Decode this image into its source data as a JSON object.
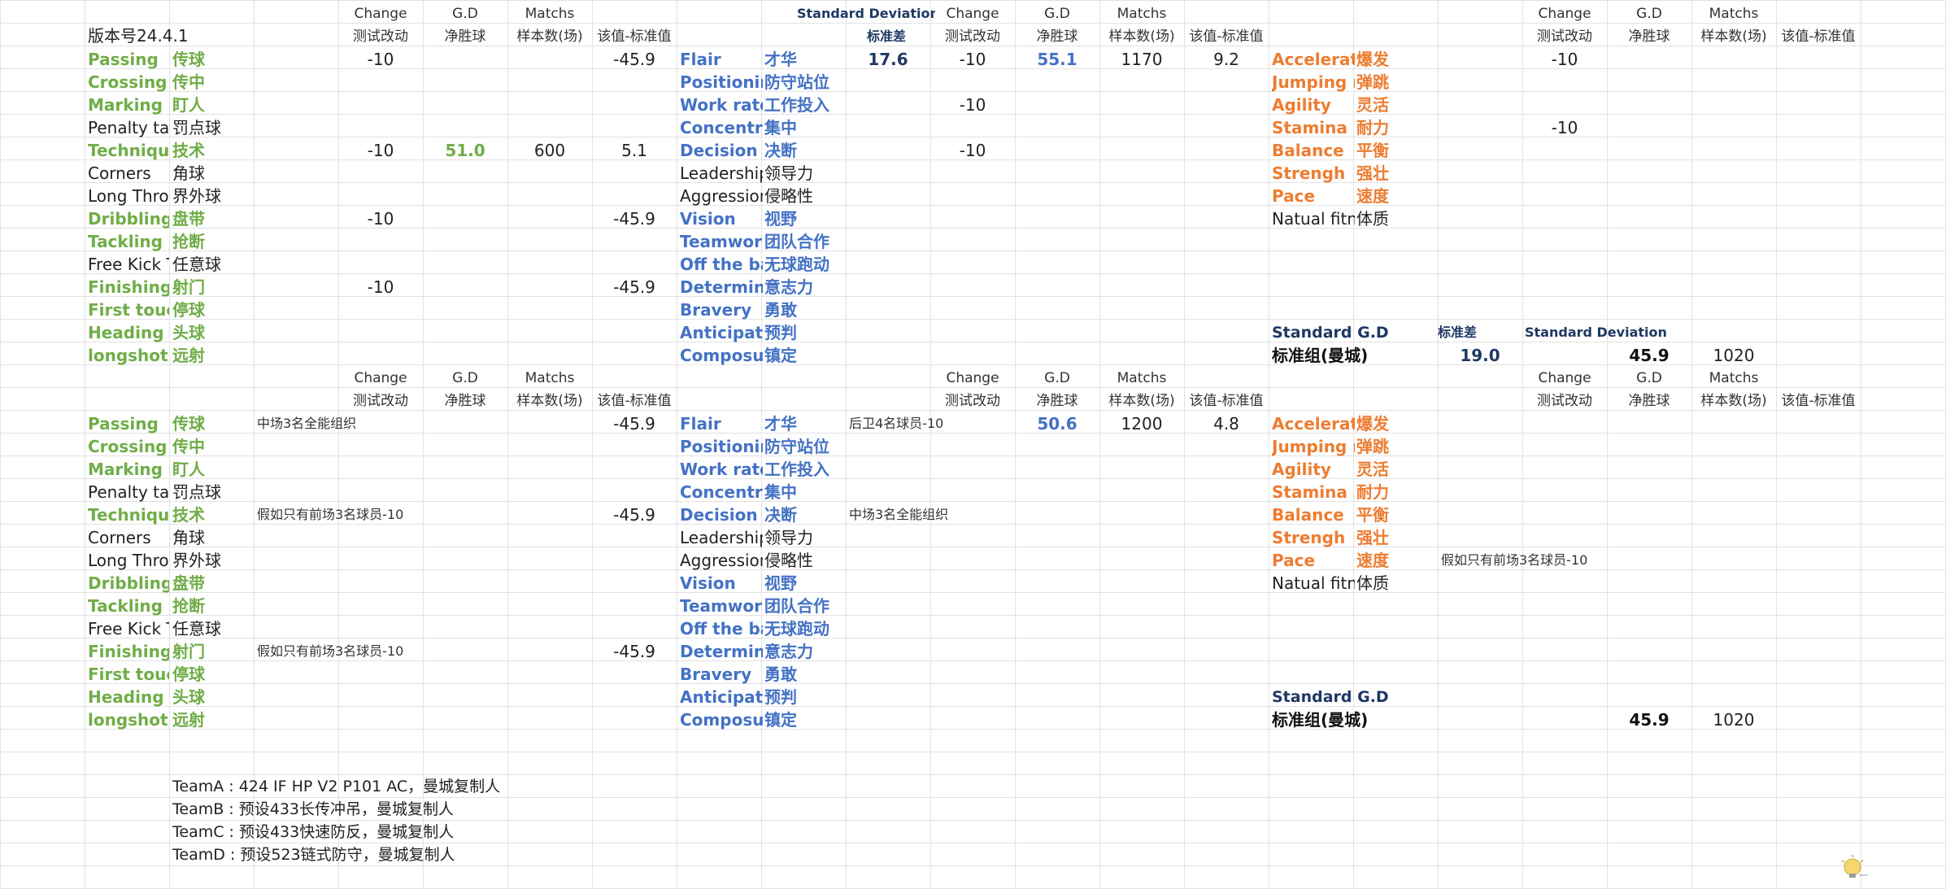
{
  "version": "版本号24.4.1",
  "headers": {
    "change": "Change",
    "gd": "G.D",
    "matchs": "Matchs",
    "change_cn": "测试改动",
    "gd_cn": "净胜球",
    "matchs_cn": "样本数(场)",
    "diff_cn": "该值-标准值"
  },
  "standard_deviation": "Standard Deviation",
  "standard_deviation_cn": "标准差",
  "technical_attrs": [
    {
      "en": "Passing",
      "cn": "传球",
      "color": "green"
    },
    {
      "en": "Crossing",
      "cn": "传中",
      "color": "green"
    },
    {
      "en": "Marking",
      "cn": "盯人",
      "color": "green"
    },
    {
      "en": "Penalty tak",
      "cn": "罚点球",
      "color": "black"
    },
    {
      "en": "Technique",
      "cn": "技术",
      "color": "green"
    },
    {
      "en": "Corners",
      "cn": "角球",
      "color": "black"
    },
    {
      "en": "Long Throv",
      "cn": "界外球",
      "color": "black"
    },
    {
      "en": "Dribbling",
      "cn": "盘带",
      "color": "green"
    },
    {
      "en": "Tackling",
      "cn": "抢断",
      "color": "green"
    },
    {
      "en": "Free Kick T",
      "cn": "任意球",
      "color": "black"
    },
    {
      "en": "Finishing",
      "cn": "射门",
      "color": "green"
    },
    {
      "en": "First touch",
      "cn": "停球",
      "color": "green"
    },
    {
      "en": "Heading",
      "cn": "头球",
      "color": "green"
    },
    {
      "en": "longshot",
      "cn": "远射",
      "color": "green"
    }
  ],
  "mental_attrs": [
    {
      "en": "Flair",
      "cn": "才华",
      "color": "blue"
    },
    {
      "en": "Positionin",
      "cn": "防守站位",
      "color": "blue"
    },
    {
      "en": "Work rate",
      "cn": "工作投入",
      "color": "blue"
    },
    {
      "en": "Concentra",
      "cn": "集中",
      "color": "blue"
    },
    {
      "en": "Decision",
      "cn": "决断",
      "color": "blue"
    },
    {
      "en": "Leadership",
      "cn": "领导力",
      "color": "black"
    },
    {
      "en": "Aggression",
      "cn": "侵略性",
      "color": "black"
    },
    {
      "en": "Vision",
      "cn": "视野",
      "color": "blue"
    },
    {
      "en": "Teamwork",
      "cn": "团队合作",
      "color": "blue"
    },
    {
      "en": "Off the ba",
      "cn": "无球跑动",
      "color": "blue"
    },
    {
      "en": "Determina",
      "cn": "意志力",
      "color": "blue"
    },
    {
      "en": "Bravery",
      "cn": "勇敢",
      "color": "blue"
    },
    {
      "en": "Anticipatic",
      "cn": "预判",
      "color": "blue"
    },
    {
      "en": "Composur",
      "cn": "镇定",
      "color": "blue"
    }
  ],
  "physical_attrs": [
    {
      "en": "Acceleratic",
      "cn": "爆发",
      "color": "orange"
    },
    {
      "en": "Jumping r",
      "cn": "弹跳",
      "color": "orange"
    },
    {
      "en": "Agility",
      "cn": "灵活",
      "color": "orange"
    },
    {
      "en": "Stamina",
      "cn": "耐力",
      "color": "orange"
    },
    {
      "en": "Balance",
      "cn": "平衡",
      "color": "orange"
    },
    {
      "en": "Strengh",
      "cn": "强壮",
      "color": "orange"
    },
    {
      "en": "Pace",
      "cn": "速度",
      "color": "orange"
    },
    {
      "en": "Natual fitn",
      "cn": "体质",
      "color": "black"
    }
  ],
  "block1": {
    "tech": [
      {
        "row": 0,
        "change": "-10",
        "diff": "-45.9"
      },
      {
        "row": 4,
        "change": "-10",
        "gd": "51.0",
        "matchs": "600",
        "diff": "5.1"
      },
      {
        "row": 7,
        "change": "-10",
        "diff": "-45.9"
      },
      {
        "row": 10,
        "change": "-10",
        "diff": "-45.9"
      }
    ],
    "mental_std": "17.6",
    "mental": [
      {
        "row": 0,
        "change": "-10",
        "gd": "55.1",
        "matchs": "1170",
        "diff": "9.2"
      },
      {
        "row": 2,
        "change": "-10"
      },
      {
        "row": 4,
        "change": "-10"
      }
    ],
    "physical": [
      {
        "row": 0,
        "change": "-10"
      },
      {
        "row": 3,
        "change": "-10"
      }
    ],
    "standard_gd": "Standard G.D",
    "standard_group": "标准组(曼城)",
    "std_value": "19.0",
    "std_gd": "45.9",
    "std_matchs": "1020"
  },
  "block2": {
    "tech": [
      {
        "row": 0,
        "note": "中场3名全能组织",
        "diff": "-45.9"
      },
      {
        "row": 4,
        "note": "假如只有前场3名球员-10",
        "diff": "-45.9"
      },
      {
        "row": 10,
        "note": "假如只有前场3名球员-10",
        "diff": "-45.9"
      }
    ],
    "mental": [
      {
        "row": 0,
        "note": "后卫4名球员-10",
        "gd": "50.6",
        "matchs": "1200",
        "diff": "4.8"
      },
      {
        "row": 4,
        "note": "中场3名全能组织"
      }
    ],
    "physical_note": "假如只有前场3名球员-10",
    "standard_gd": "Standard G.D",
    "standard_group": "标准组(曼城)",
    "std_gd": "45.9",
    "std_matchs": "1020"
  },
  "teams": [
    "TeamA : 424 IF HP V2 P101 AC，曼城复制人",
    "TeamB : 预设433长传冲吊，曼城复制人",
    "TeamC : 预设433快速防反，曼城复制人",
    "TeamD : 预设523链式防守，曼城复制人"
  ],
  "colors": {
    "green": "#70ad47",
    "blue": "#4472c4",
    "orange": "#ed7d31",
    "navy": "#1f3864",
    "grid": "#e2e2e2"
  }
}
